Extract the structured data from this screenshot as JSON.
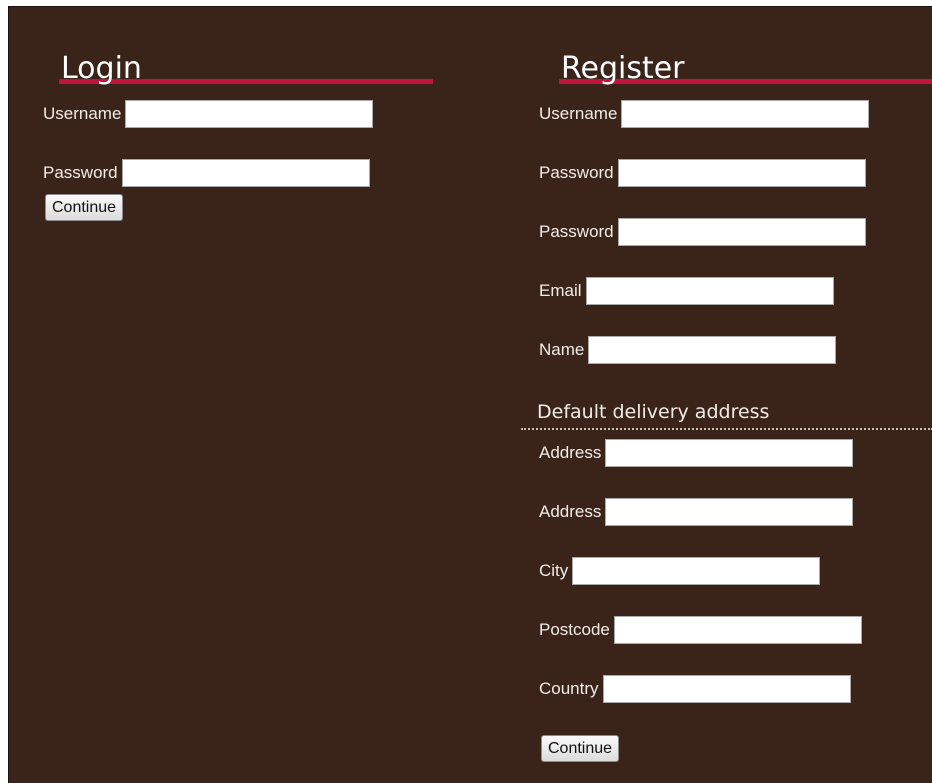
{
  "login": {
    "title": "Login",
    "fields": [
      {
        "label": "Username",
        "value": ""
      },
      {
        "label": "Password",
        "value": ""
      }
    ],
    "continue_label": "Continue"
  },
  "register": {
    "title": "Register",
    "fields": [
      {
        "label": "Username",
        "value": ""
      },
      {
        "label": "Password",
        "value": ""
      },
      {
        "label": "Password",
        "value": ""
      },
      {
        "label": "Email",
        "value": ""
      },
      {
        "label": "Name",
        "value": ""
      }
    ],
    "delivery_heading": "Default delivery address",
    "address_fields": [
      {
        "label": "Address",
        "value": ""
      },
      {
        "label": "Address",
        "value": ""
      },
      {
        "label": "City",
        "value": ""
      },
      {
        "label": "Postcode",
        "value": ""
      },
      {
        "label": "Country",
        "value": ""
      }
    ],
    "continue_label": "Continue"
  },
  "colors": {
    "background": "#3a2419",
    "heading_underline": "#c2123e",
    "text": "#f3ece6"
  }
}
